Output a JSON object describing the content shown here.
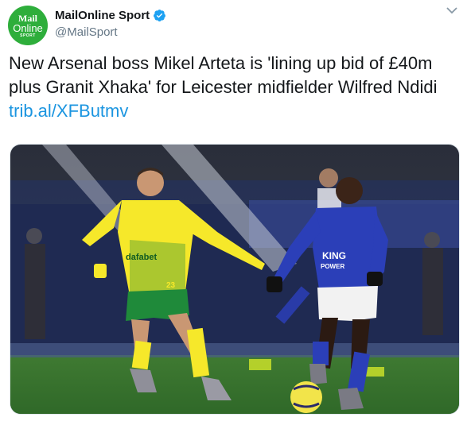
{
  "account": {
    "display_name": "MailOnline Sport",
    "handle": "@MailSport",
    "avatar_text": [
      "Mail",
      "Online",
      "SPORT"
    ],
    "verified": true
  },
  "tweet": {
    "text": "New Arsenal boss Mikel Arteta is 'lining up bid of £40m plus Granit Xhaka' for Leicester midfielder Wilfred Ndidi",
    "link": "trib.al/XFButmv"
  },
  "media": {
    "kit_text": {
      "norwich_sponsor": "dafabet",
      "leicester_sponsor_1": "KING",
      "leicester_sponsor_2": "POWER",
      "norwich_number": "23"
    }
  },
  "colors": {
    "avatar_green": "#2eae3b",
    "link_blue": "#1b95e0",
    "verified_blue": "#1da1f2",
    "norwich_yellow": "#f6e82a",
    "norwich_green": "#1f8a3a",
    "leicester_blue": "#2b3fb8"
  },
  "icons": [
    "verified-badge-icon",
    "caret-down-icon"
  ]
}
